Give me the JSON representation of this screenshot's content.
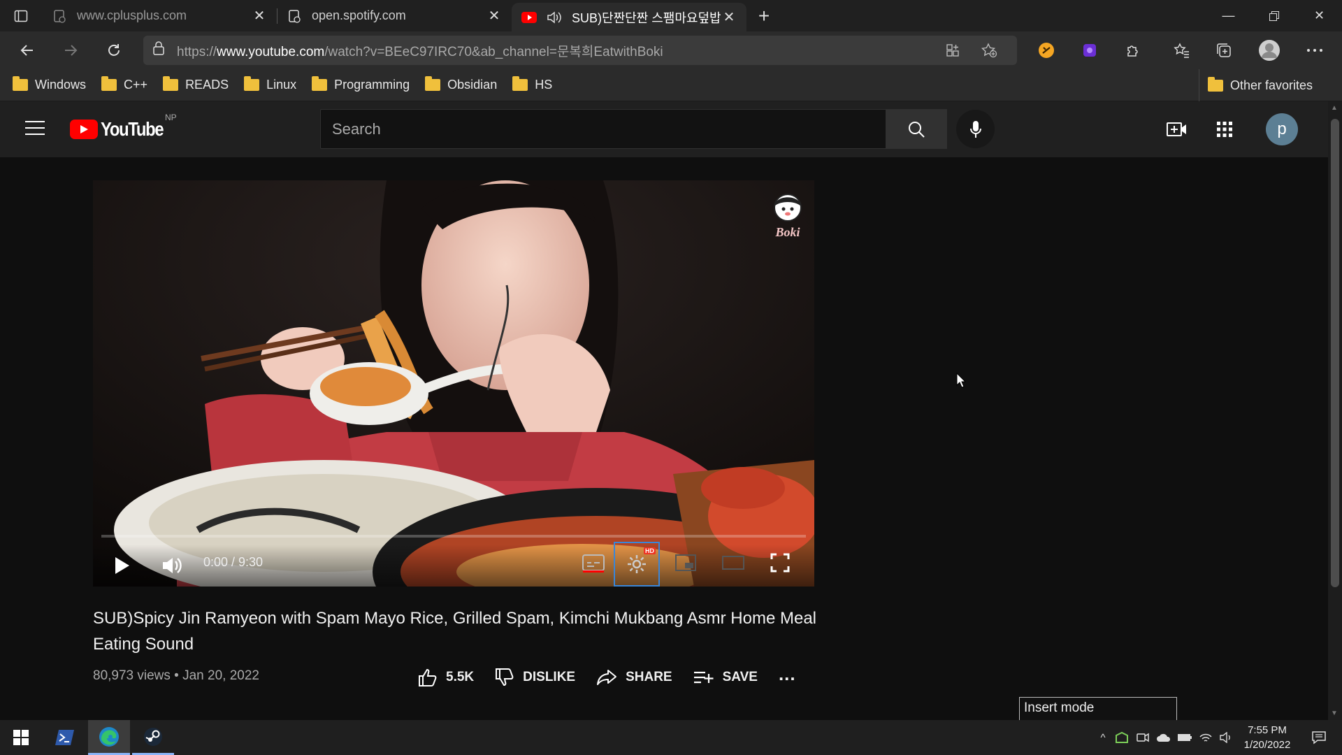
{
  "browser": {
    "tabs": [
      {
        "title": "www.cplusplus.com",
        "active": false
      },
      {
        "title": "open.spotify.com",
        "active": false
      },
      {
        "title": "SUB)단짠단짠 스팸마요덮밥",
        "active": true
      }
    ],
    "address": {
      "prefix": "https://",
      "domain": "www.youtube.com",
      "path": "/watch?v=BEeC97IRC70&ab_channel=문복희EatwithBoki"
    },
    "favorites": [
      "Windows",
      "C++",
      "READS",
      "Linux",
      "Programming",
      "Obsidian",
      "HS"
    ],
    "other_favorites": "Other favorites"
  },
  "youtube": {
    "logo_text": "YouTube",
    "country_code": "NP",
    "search_placeholder": "Search",
    "avatar_letter": "p",
    "brand_color": "#ff0000"
  },
  "video": {
    "watermark": "Boki",
    "time": "0:00 / 9:30",
    "hd_badge": "HD",
    "progress": 0,
    "title": "SUB)Spicy Jin Ramyeon with Spam Mayo Rice, Grilled Spam, Kimchi Mukbang Asmr Home Meal Eating Sound",
    "views_date": "80,973 views • Jan 20, 2022",
    "likes": "5.5K",
    "dislike_label": "DISLIKE",
    "share_label": "SHARE",
    "save_label": "SAVE",
    "more_label": "..."
  },
  "status": {
    "insert_mode": "Insert mode"
  },
  "taskbar": {
    "time": "7:55 PM",
    "date": "1/20/2022"
  }
}
